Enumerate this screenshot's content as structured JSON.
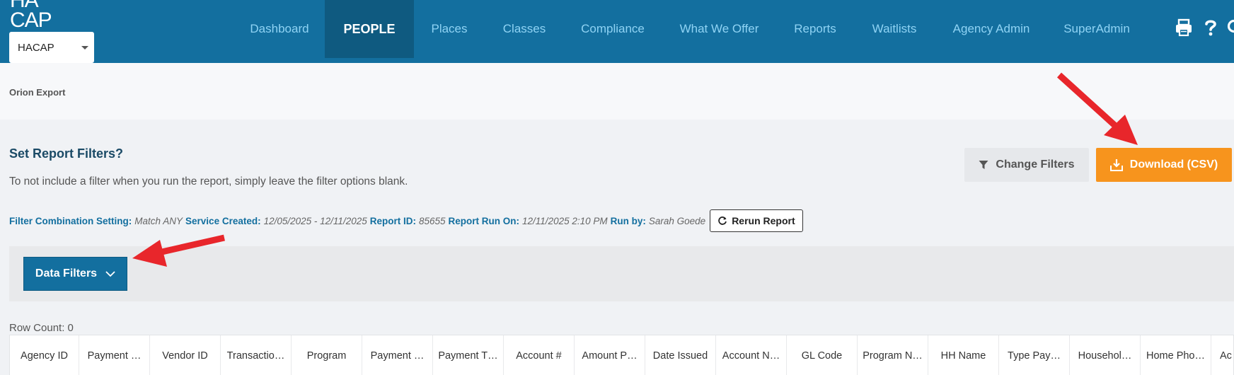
{
  "header": {
    "logo_line1": "HA",
    "logo_line2": "CAP",
    "agency_selected": "HACAP",
    "nav": [
      {
        "label": "Dashboard",
        "active": false
      },
      {
        "label": "PEOPLE",
        "active": true
      },
      {
        "label": "Places",
        "active": false
      },
      {
        "label": "Classes",
        "active": false
      },
      {
        "label": "Compliance",
        "active": false
      },
      {
        "label": "What We Offer",
        "active": false
      },
      {
        "label": "Reports",
        "active": false
      },
      {
        "label": "Waitlists",
        "active": false
      },
      {
        "label": "Agency Admin",
        "active": false
      },
      {
        "label": "SuperAdmin",
        "active": false
      }
    ],
    "icons": [
      "print-icon",
      "help-icon",
      "search-icon"
    ]
  },
  "breadcrumb": "Orion Export",
  "report": {
    "title": "Set Report Filters?",
    "description": "To not include a filter when you run the report, simply leave the filter options blank.",
    "filter_combo_label": "Filter Combination Setting:",
    "filter_combo_value": "Match ANY",
    "service_created_label": "Service Created:",
    "service_created_value": "12/05/2025 - 12/11/2025",
    "report_id_label": "Report ID:",
    "report_id_value": "85655",
    "run_on_label": "Report Run On:",
    "run_on_value": "12/11/2025 2:10 PM",
    "run_by_label": "Run by:",
    "run_by_value": "Sarah Goede",
    "rerun_label": "Rerun Report",
    "change_filters_label": "Change Filters",
    "download_label": "Download (CSV)",
    "data_filters_label": "Data Filters",
    "row_count": "Row Count: 0"
  },
  "table": {
    "columns": [
      "Agency ID",
      "Payment …",
      "Vendor ID",
      "Transactio…",
      "Program",
      "Payment …",
      "Payment T…",
      "Account #",
      "Amount P…",
      "Date Issued",
      "Account N…",
      "GL Code",
      "Program N…",
      "HH Name",
      "Type Pay…",
      "Househol…",
      "Home Pho…",
      "Ac"
    ]
  },
  "colors": {
    "nav_bg": "#136f9f",
    "nav_active_bg": "#0f5a80",
    "nav_text": "#8fd3f4",
    "download": "#f7941d",
    "annotation_arrow": "#e8262b"
  }
}
